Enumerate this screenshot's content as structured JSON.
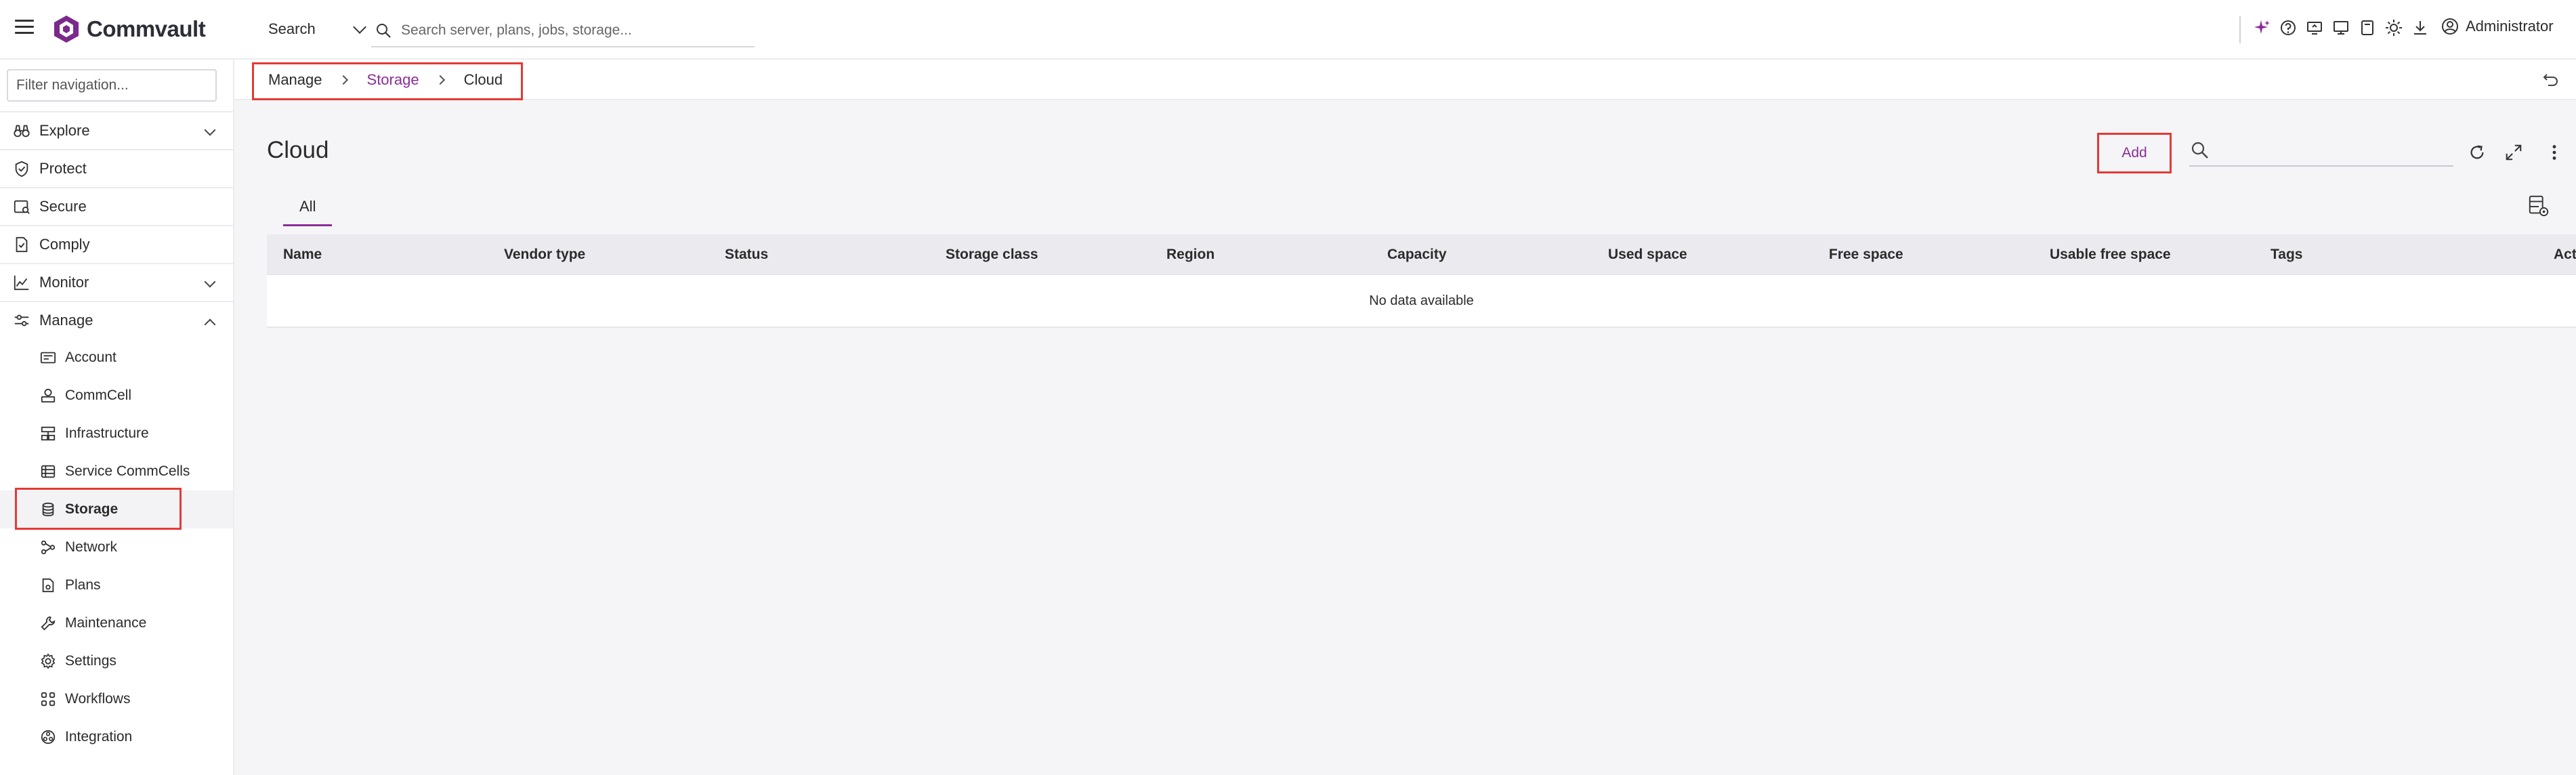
{
  "app": {
    "logo_text": "Commvault",
    "brand_color": "#8b2d99"
  },
  "topbar": {
    "search_scope": "Search",
    "search_placeholder": "Search server, plans, jobs, storage...",
    "icons": [
      "sparkle-icon",
      "help-icon",
      "remote-desktop-icon",
      "monitor-icon",
      "tablet-icon",
      "theme-icon",
      "download-icon"
    ],
    "user_name": "Administrator"
  },
  "sidebar": {
    "filter_placeholder": "Filter navigation...",
    "items": [
      {
        "label": "Explore",
        "icon": "binoculars-icon",
        "expandable": true,
        "expanded": false
      },
      {
        "label": "Protect",
        "icon": "shield-check-icon"
      },
      {
        "label": "Secure",
        "icon": "secure-icon"
      },
      {
        "label": "Comply",
        "icon": "document-check-icon"
      },
      {
        "label": "Monitor",
        "icon": "chart-line-icon",
        "expandable": true,
        "expanded": false
      },
      {
        "label": "Manage",
        "icon": "sliders-icon",
        "expandable": true,
        "expanded": true
      }
    ],
    "manage_children": [
      {
        "label": "Account",
        "icon": "id-card-icon"
      },
      {
        "label": "CommCell",
        "icon": "commcell-icon"
      },
      {
        "label": "Infrastructure",
        "icon": "infrastructure-icon"
      },
      {
        "label": "Service CommCells",
        "icon": "service-commcells-icon"
      },
      {
        "label": "Storage",
        "icon": "database-icon",
        "active": true
      },
      {
        "label": "Network",
        "icon": "network-icon"
      },
      {
        "label": "Plans",
        "icon": "plans-icon"
      },
      {
        "label": "Maintenance",
        "icon": "wrench-icon"
      },
      {
        "label": "Settings",
        "icon": "gear-icon"
      },
      {
        "label": "Workflows",
        "icon": "workflows-icon"
      },
      {
        "label": "Integration",
        "icon": "integration-icon"
      }
    ]
  },
  "breadcrumb": [
    "Manage",
    "Storage",
    "Cloud"
  ],
  "page": {
    "title": "Cloud",
    "add_label": "Add",
    "tabs": [
      "All"
    ],
    "columns": [
      "Name",
      "Vendor type",
      "Status",
      "Storage class",
      "Region",
      "Capacity",
      "Used space",
      "Free space",
      "Usable free space",
      "Tags",
      "Actions"
    ],
    "empty_text": "No data available"
  }
}
